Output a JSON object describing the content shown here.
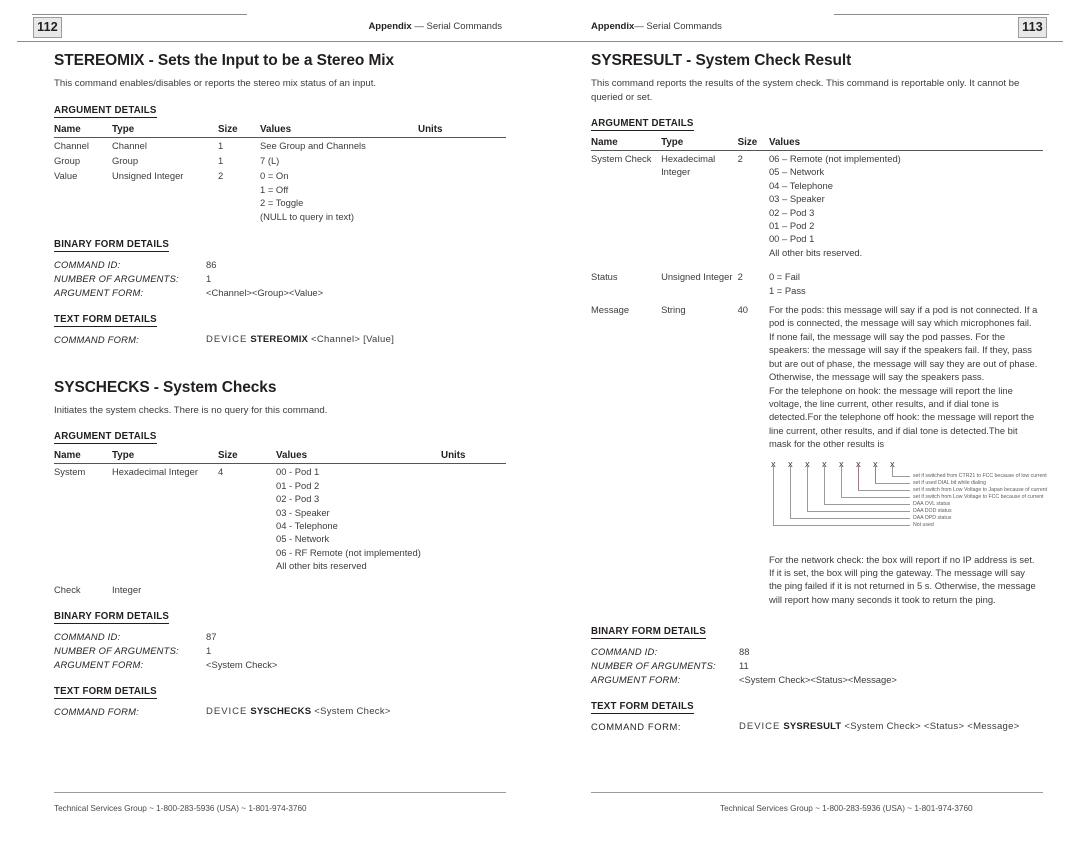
{
  "left_page": {
    "header": {
      "page_number": "112",
      "appendix": "Appendix",
      "dash": "—",
      "section": "Serial Commands"
    },
    "footer": "Technical Services Group ~ 1-800-283-5936 (USA) ~ 1-801-974-3760",
    "commands": [
      {
        "title": "STEREOMIX - Sets the Input to be a Stereo Mix",
        "description": "This command enables/disables or reports the stereo mix status of an input.",
        "argument_details_label": "ARGUMENT DETAILS",
        "table": {
          "headers": [
            "Name",
            "Type",
            "Size",
            "Values",
            "Units"
          ],
          "rows": [
            {
              "name": "Channel",
              "type": "Channel",
              "size": "1",
              "values": [
                "See Group and Channels"
              ],
              "units": ""
            },
            {
              "name": "Group",
              "type": "Group",
              "size": "1",
              "values": [
                "7 (L)"
              ],
              "units": ""
            },
            {
              "name": "Value",
              "type": "Unsigned Integer",
              "size": "2",
              "values": [
                "0 = On",
                "1 = Off",
                "2 = Toggle",
                "(NULL to query in text)"
              ],
              "units": ""
            }
          ]
        },
        "binary_form_label": "BINARY FORM DETAILS",
        "binary_form": [
          {
            "key": "COMMAND ID:",
            "value": "86"
          },
          {
            "key": "NUMBER OF ARGUMENTS:",
            "value": "1"
          },
          {
            "key": "ARGUMENT FORM:",
            "value": "<Channel><Group><Value>"
          }
        ],
        "text_form_label": "TEXT FORM DETAILS",
        "text_form": {
          "key": "COMMAND FORM:",
          "device": "DEVICE",
          "command": "STEREOMIX",
          "args": "<Channel> [Value]"
        }
      },
      {
        "title": "SYSCHECKS - System Checks",
        "description": "Initiates the system checks. There is no query for this command.",
        "argument_details_label": "ARGUMENT DETAILS",
        "table": {
          "headers": [
            "Name",
            "Type",
            "Size",
            "Values",
            "Units"
          ],
          "rows": [
            {
              "name": "System",
              "type": "Hexadecimal Integer",
              "size": "4",
              "values": [
                "00 - Pod 1",
                "01 - Pod 2",
                "02 - Pod 3",
                "03 - Speaker",
                "04 - Telephone",
                "05 - Network",
                "06 - RF Remote (not implemented)",
                "All other bits reserved"
              ],
              "units": ""
            },
            {
              "name": "Check",
              "type": "Integer",
              "size": "",
              "values": [],
              "units": ""
            }
          ]
        },
        "binary_form_label": "BINARY FORM DETAILS",
        "binary_form": [
          {
            "key": "COMMAND ID:",
            "value": "87"
          },
          {
            "key": "NUMBER OF ARGUMENTS:",
            "value": "1"
          },
          {
            "key": "ARGUMENT FORM:",
            "value": "<System Check>"
          }
        ],
        "text_form_label": "TEXT FORM DETAILS",
        "text_form": {
          "key": "COMMAND FORM:",
          "device": "DEVICE",
          "command": "SYSCHECKS",
          "args": "<System Check>"
        }
      }
    ]
  },
  "right_page": {
    "header": {
      "page_number": "113",
      "appendix": "Appendix",
      "dash": "—",
      "section": "Serial Commands"
    },
    "footer": "Technical Services Group ~ 1-800-283-5936 (USA) ~ 1-801-974-3760",
    "command": {
      "title": "SYSRESULT - System Check Result",
      "description": "This command reports the results of the system check. This command is reportable only. It cannot be queried or set.",
      "argument_details_label": "ARGUMENT DETAILS",
      "table": {
        "headers": [
          "Name",
          "Type",
          "Size",
          "Values"
        ],
        "rows": [
          {
            "name": "System Check",
            "type": "Hexadecimal Integer",
            "size": "2",
            "values": [
              "06 – Remote (not implemented)",
              "05 – Network",
              "04 – Telephone",
              "03 – Speaker",
              "02 – Pod 3",
              "01 – Pod 2",
              "00 – Pod 1",
              "All other bits reserved."
            ]
          },
          {
            "name": "Status",
            "type": "Unsigned Integer",
            "size": "2",
            "values": [
              "0 = Fail",
              "1 = Pass"
            ]
          },
          {
            "name": "Message",
            "type": "String",
            "size": "40",
            "values": [
              "For the pods: this message will say if a pod is not connected. If a pod is connected, the message will say which microphones fail. If none fail, the message will say the pod passes. For the speakers: the message will say if the speakers fail. If they, pass but are out of phase, the message will say they are out of phase. Otherwise, the message will say the speakers pass.",
              "For the telephone on hook: the message will report the line voltage, the line current, other results, and if dial tone is detected.For the telephone off hook: the message will report the line current, other results, and if dial tone is detected.The bit mask for the other results is"
            ],
            "values_after_diagram": [
              "For the network check: the box will report if no IP address is set. If it is set, the box will ping the gateway. The message will say the ping failed if it is not returned in 5 s. Otherwise, the message will report how many seconds it took to return the ping."
            ]
          }
        ]
      },
      "bitmask": {
        "bits": [
          "x",
          "x",
          "x",
          "x",
          "x",
          "x",
          "x",
          "x"
        ],
        "labels": [
          "set if switched from CTR21 to FCC because of low current",
          "set if used DIAL bit while dialing",
          "set if switch from Low Voltage to Japan because of current",
          "set if switch from Low Voltage to FCC because of current",
          "DAA OVL status",
          "DAA DOD status",
          "DAA OPD status",
          "Not used"
        ]
      },
      "binary_form_label": "BINARY FORM DETAILS",
      "binary_form": [
        {
          "key": "COMMAND ID:",
          "value": "88"
        },
        {
          "key": "NUMBER OF ARGUMENTS:",
          "value": "11"
        },
        {
          "key": "ARGUMENT FORM:",
          "value": "<System Check><Status><Message>"
        }
      ],
      "text_form_label": "TEXT FORM DETAILS",
      "text_form": {
        "key": "COMMAND FORM:",
        "device": "DEVICE",
        "command": "SYSRESULT",
        "args": "<System Check> <Status> <Message>"
      }
    }
  }
}
